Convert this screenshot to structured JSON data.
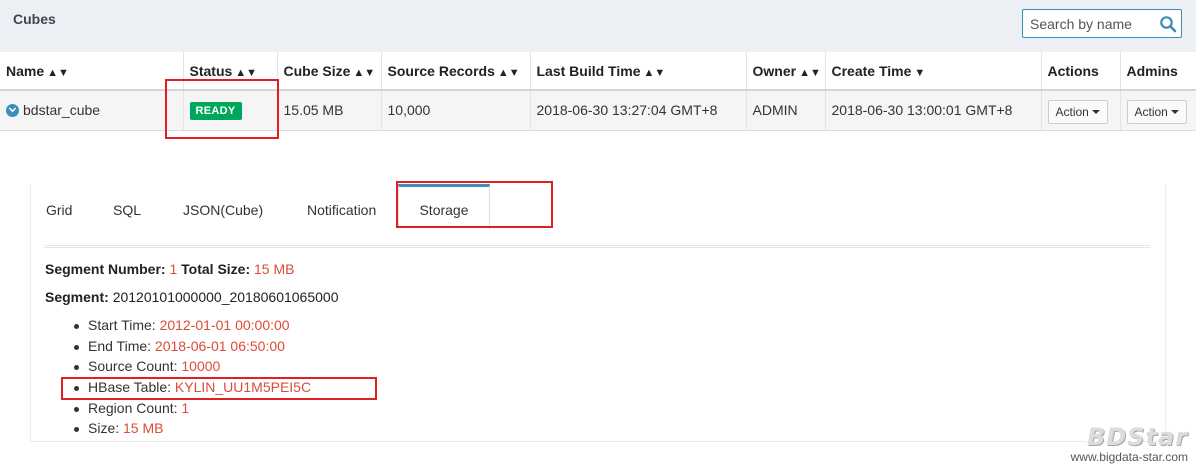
{
  "header": {
    "title": "Cubes",
    "search_placeholder": "Search by name"
  },
  "table": {
    "columns": [
      "Name",
      "Status",
      "Cube Size",
      "Source Records",
      "Last Build Time",
      "Owner",
      "Create Time",
      "Actions",
      "Admins"
    ],
    "sort_glyph": "⇕",
    "rows": [
      {
        "name": "bdstar_cube",
        "status": "READY",
        "cube_size": "15.05 MB",
        "source_records": "10,000",
        "last_build_time": "2018-06-30 13:27:04 GMT+8",
        "owner": "ADMIN",
        "create_time": "2018-06-30 13:00:01 GMT+8",
        "actions": "Action",
        "admins": "Action"
      }
    ]
  },
  "tabs": [
    "Grid",
    "SQL",
    "JSON(Cube)",
    "Notification",
    "Storage"
  ],
  "active_tab": "Storage",
  "storage": {
    "segment_number_label": "Segment Number:",
    "segment_number": "1",
    "total_size_label": "Total Size:",
    "total_size": "15 MB",
    "segment_label": "Segment:",
    "segment_name": "20120101000000_20180601065000",
    "details": [
      {
        "label": "Start Time:",
        "value": "2012-01-01 00:00:00"
      },
      {
        "label": "End Time:",
        "value": "2018-06-01 06:50:00"
      },
      {
        "label": "Source Count:",
        "value": "10000"
      },
      {
        "label": "HBase Table:",
        "value": "KYLIN_UU1M5PEI5C"
      },
      {
        "label": "Region Count:",
        "value": "1"
      },
      {
        "label": "Size:",
        "value": "15 MB"
      }
    ]
  },
  "watermark": {
    "logo": "BDStar",
    "url": "www.bigdata-star.com"
  },
  "colors": {
    "accent": "#3c8dbc",
    "ready": "#00a65a",
    "value_red": "#dd4b39",
    "highlight_box": "#e02020"
  }
}
